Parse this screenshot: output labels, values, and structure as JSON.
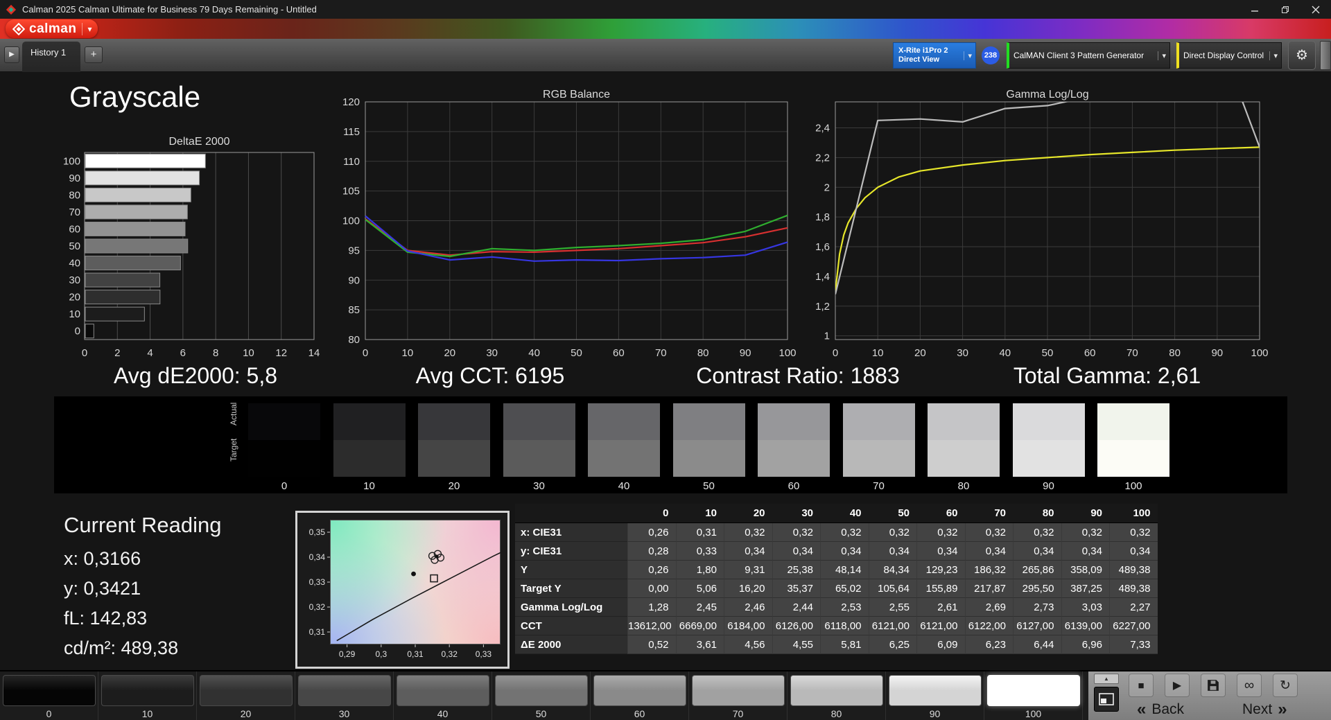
{
  "window": {
    "title": "Calman 2025 Calman Ultimate for Business 79 Days Remaining  - Untitled"
  },
  "brand": {
    "logo_text": "calman"
  },
  "icons": {
    "caret": "▾",
    "nav_arrow": "▶",
    "add_tab": "+",
    "gear": "⚙",
    "stop": "■",
    "play": "▶",
    "link": "∞",
    "refresh": "↻",
    "panel_up": "▲",
    "back_chevron": "«",
    "next_chevron": "»"
  },
  "tabbar": {
    "tab": "History 1",
    "meter": {
      "line1": "X-Rite i1Pro 2",
      "line2": "Direct View"
    },
    "badge": "238",
    "pattern_generator": "CalMAN Client 3 Pattern Generator",
    "display_control": "Direct Display Control"
  },
  "page": {
    "title": "Grayscale"
  },
  "stats": [
    "Avg dE2000: 5,8",
    "Avg CCT: 6195",
    "Contrast Ratio: 1883",
    "Total Gamma: 2,61"
  ],
  "chart_data": [
    {
      "type": "bar",
      "name": "deltae",
      "title": "DeltaE 2000",
      "orientation": "horizontal",
      "categories": [
        "100",
        "90",
        "80",
        "70",
        "60",
        "50",
        "40",
        "30",
        "20",
        "10",
        "0"
      ],
      "values": [
        7.33,
        6.96,
        6.44,
        6.23,
        6.09,
        6.25,
        5.81,
        4.55,
        4.56,
        3.61,
        0.52
      ],
      "bar_colors": [
        "#ffffff",
        "#e2e2e2",
        "#c8c8c8",
        "#adadad",
        "#929292",
        "#777777",
        "#5d5d5d",
        "#424242",
        "#2e2e2e",
        "#1c1c1c",
        "#0a0a0a"
      ],
      "xlim": [
        0,
        14
      ],
      "x_ticks": [
        0,
        2,
        4,
        6,
        8,
        10,
        12,
        14
      ],
      "x_tick_labels": [
        "0",
        "2",
        "4",
        "6",
        "8",
        "10",
        "12",
        "14"
      ]
    },
    {
      "type": "line",
      "name": "rgb_balance",
      "title": "RGB Balance",
      "x": [
        0,
        10,
        20,
        30,
        40,
        50,
        60,
        70,
        80,
        90,
        100
      ],
      "series": [
        {
          "name": "Red",
          "color": "#d83030",
          "values": [
            100.3,
            95.0,
            94.2,
            94.8,
            94.7,
            95.0,
            95.3,
            95.8,
            96.3,
            97.3,
            98.8
          ]
        },
        {
          "name": "Green",
          "color": "#2fae2f",
          "values": [
            100.2,
            94.7,
            94.0,
            95.3,
            95.0,
            95.5,
            95.8,
            96.2,
            96.8,
            98.2,
            100.9
          ]
        },
        {
          "name": "Blue",
          "color": "#3636e2",
          "values": [
            100.8,
            94.9,
            93.4,
            93.9,
            93.2,
            93.4,
            93.3,
            93.6,
            93.8,
            94.2,
            96.4
          ]
        }
      ],
      "ylim": [
        80,
        120
      ],
      "y_ticks": [
        120,
        115,
        110,
        105,
        100,
        95,
        90,
        85,
        80
      ],
      "y_tick_labels": [
        "120",
        "115",
        "110",
        "105",
        "100",
        "95",
        "90",
        "85",
        "80"
      ],
      "x_ticks": [
        0,
        10,
        20,
        30,
        40,
        50,
        60,
        70,
        80,
        90,
        100
      ],
      "x_tick_labels": [
        "0",
        "10",
        "20",
        "30",
        "40",
        "50",
        "60",
        "70",
        "80",
        "90",
        "100"
      ]
    },
    {
      "type": "line",
      "name": "gamma",
      "title": "Gamma Log/Log",
      "ylim_draw": [
        0.975,
        2.575
      ],
      "y_ticks": [
        2.4,
        2.2,
        2.0,
        1.8,
        1.6,
        1.4,
        1.2,
        1.0
      ],
      "y_tick_labels": [
        "2,4",
        "2,2",
        "2",
        "1,8",
        "1,6",
        "1,4",
        "1,2",
        "1"
      ],
      "x_ticks": [
        0,
        10,
        20,
        30,
        40,
        50,
        60,
        70,
        80,
        90,
        100
      ],
      "x_tick_labels": [
        "0",
        "10",
        "20",
        "30",
        "40",
        "50",
        "60",
        "70",
        "80",
        "90",
        "100"
      ],
      "series": [
        {
          "name": "Target",
          "color": "#e6e62a",
          "x": [
            0,
            1,
            2,
            3,
            5,
            7,
            10,
            15,
            20,
            30,
            40,
            50,
            60,
            70,
            80,
            90,
            100
          ],
          "values": [
            1.3,
            1.55,
            1.68,
            1.76,
            1.86,
            1.93,
            2.0,
            2.07,
            2.11,
            2.15,
            2.18,
            2.2,
            2.22,
            2.235,
            2.25,
            2.26,
            2.27
          ]
        },
        {
          "name": "Measured",
          "color": "#bcbcbc",
          "x": [
            0,
            10,
            20,
            30,
            40,
            50,
            60,
            70,
            80,
            90,
            100
          ],
          "values": [
            1.28,
            2.45,
            2.46,
            2.44,
            2.53,
            2.55,
            2.61,
            2.69,
            2.73,
            3.03,
            2.27
          ]
        }
      ]
    }
  ],
  "swatches": {
    "actual_label": "Actual",
    "target_label": "Target",
    "items": [
      {
        "label": "0",
        "actual": "#08080a",
        "target": "#010101"
      },
      {
        "label": "10",
        "actual": "#202022",
        "target": "#2c2c2c"
      },
      {
        "label": "20",
        "actual": "#37373a",
        "target": "#454545"
      },
      {
        "label": "30",
        "actual": "#4e4e51",
        "target": "#5b5b5b"
      },
      {
        "label": "40",
        "actual": "#666669",
        "target": "#737373"
      },
      {
        "label": "50",
        "actual": "#7f7f82",
        "target": "#8b8b8b"
      },
      {
        "label": "60",
        "actual": "#97979a",
        "target": "#a2a2a2"
      },
      {
        "label": "70",
        "actual": "#aeaeb1",
        "target": "#b8b8b8"
      },
      {
        "label": "80",
        "actual": "#c5c5c7",
        "target": "#cecece"
      },
      {
        "label": "90",
        "actual": "#dadadc",
        "target": "#e2e2e2"
      },
      {
        "label": "100",
        "actual": "#f1f4ec",
        "target": "#fcfcf6"
      }
    ]
  },
  "current_reading": {
    "title": "Current Reading",
    "lines": [
      "x: 0,3166",
      "y: 0,3421",
      "fL: 142,83",
      "cd/m²: 489,38"
    ]
  },
  "cie": {
    "xlim": [
      0.285,
      0.335
    ],
    "ylim": [
      0.305,
      0.355
    ],
    "x_ticks": [
      0.29,
      0.3,
      0.31,
      0.32,
      0.33
    ],
    "x_tick_labels": [
      "0,29",
      "0,3",
      "0,31",
      "0,32",
      "0,33"
    ],
    "y_ticks": [
      0.35,
      0.34,
      0.33,
      0.32,
      0.31
    ],
    "y_tick_labels": [
      "0,35",
      "0,34",
      "0,33",
      "0,32",
      "0,31"
    ],
    "locus": [
      [
        0.287,
        0.3065
      ],
      [
        0.2975,
        0.315
      ],
      [
        0.309,
        0.3235
      ],
      [
        0.321,
        0.332
      ],
      [
        0.333,
        0.3405
      ],
      [
        0.335,
        0.3418
      ]
    ],
    "markers": {
      "target_square": [
        0.3155,
        0.3315
      ],
      "reference_dot": [
        0.3095,
        0.3333
      ],
      "cluster": [
        [
          0.315,
          0.3405
        ],
        [
          0.3166,
          0.3413
        ],
        [
          0.3174,
          0.3398
        ],
        [
          0.3157,
          0.3389
        ]
      ],
      "cluster_dot": [
        0.3163,
        0.3403
      ]
    }
  },
  "table": {
    "columns": [
      "0",
      "10",
      "20",
      "30",
      "40",
      "50",
      "60",
      "70",
      "80",
      "90",
      "100"
    ],
    "rows": [
      {
        "label": "x: CIE31",
        "values": [
          "0,26",
          "0,31",
          "0,32",
          "0,32",
          "0,32",
          "0,32",
          "0,32",
          "0,32",
          "0,32",
          "0,32",
          "0,32"
        ]
      },
      {
        "label": "y: CIE31",
        "values": [
          "0,28",
          "0,33",
          "0,34",
          "0,34",
          "0,34",
          "0,34",
          "0,34",
          "0,34",
          "0,34",
          "0,34",
          "0,34"
        ]
      },
      {
        "label": "Y",
        "values": [
          "0,26",
          "1,80",
          "9,31",
          "25,38",
          "48,14",
          "84,34",
          "129,23",
          "186,32",
          "265,86",
          "358,09",
          "489,38"
        ]
      },
      {
        "label": "Target Y",
        "values": [
          "0,00",
          "5,06",
          "16,20",
          "35,37",
          "65,02",
          "105,64",
          "155,89",
          "217,87",
          "295,50",
          "387,25",
          "489,38"
        ]
      },
      {
        "label": "Gamma Log/Log",
        "values": [
          "1,28",
          "2,45",
          "2,46",
          "2,44",
          "2,53",
          "2,55",
          "2,61",
          "2,69",
          "2,73",
          "3,03",
          "2,27"
        ]
      },
      {
        "label": "CCT",
        "values": [
          "13612,00",
          "6669,00",
          "6184,00",
          "6126,00",
          "6118,00",
          "6121,00",
          "6121,00",
          "6122,00",
          "6127,00",
          "6139,00",
          "6227,00"
        ]
      },
      {
        "label": "ΔE 2000",
        "values": [
          "0,52",
          "3,61",
          "4,56",
          "4,55",
          "5,81",
          "6,25",
          "6,09",
          "6,23",
          "6,44",
          "6,96",
          "7,33"
        ]
      }
    ]
  },
  "toolbar": {
    "levels": [
      {
        "label": "0",
        "color": "#050505"
      },
      {
        "label": "10",
        "color": "#1c1c1c"
      },
      {
        "label": "20",
        "color": "#313131"
      },
      {
        "label": "30",
        "color": "#474747"
      },
      {
        "label": "40",
        "color": "#5d5d5d"
      },
      {
        "label": "50",
        "color": "#737373"
      },
      {
        "label": "60",
        "color": "#8a8a8a"
      },
      {
        "label": "70",
        "color": "#a1a1a1"
      },
      {
        "label": "80",
        "color": "#b9b9b9"
      },
      {
        "label": "90",
        "color": "#d4d4d4"
      },
      {
        "label": "100",
        "color": "#ffffff",
        "selected": true
      }
    ],
    "back_label": "Back",
    "next_label": "Next"
  }
}
